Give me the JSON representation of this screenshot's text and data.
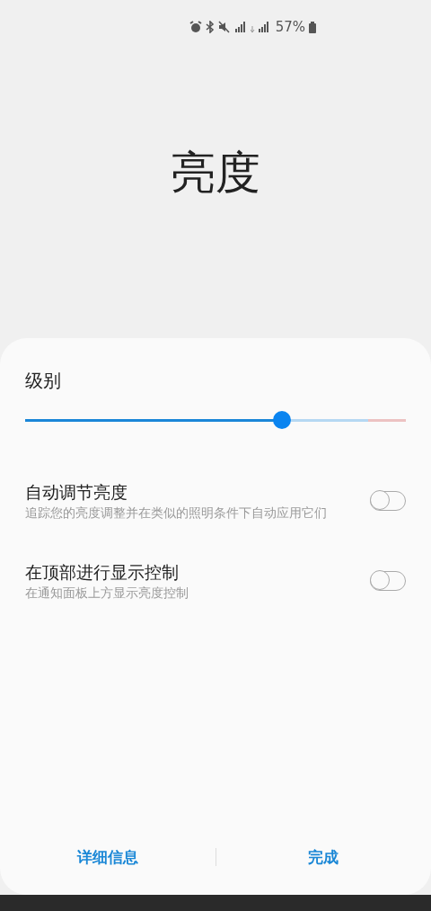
{
  "status_bar": {
    "battery": "57%"
  },
  "title": "亮度",
  "level_section": {
    "label": "级别",
    "slider": {
      "level": 0.675
    }
  },
  "settings": [
    {
      "title": "自动调节亮度",
      "description": "追踪您的亮度调整并在类似的照明条件下自动应用它们",
      "on": false
    },
    {
      "title": "在顶部进行显示控制",
      "description": "在通知面板上方显示亮度控制",
      "on": false
    }
  ],
  "buttons": [
    "详细信息",
    "完成"
  ]
}
